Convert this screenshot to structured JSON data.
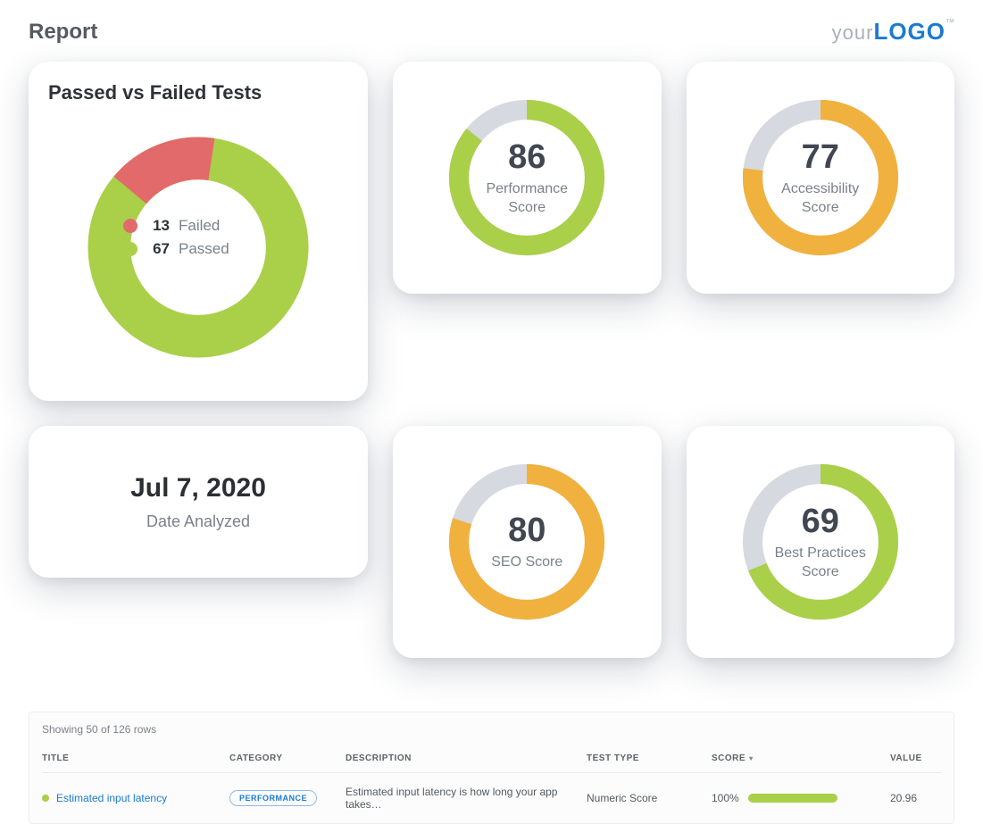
{
  "header": {
    "title": "Report",
    "logo_prefix": "your",
    "logo_brand": "LOGO",
    "logo_tm": "™"
  },
  "passfail": {
    "title": "Passed vs Failed Tests",
    "failed_label": "Failed",
    "failed_value": "13",
    "passed_label": "Passed",
    "passed_value": "67"
  },
  "date_card": {
    "value": "Jul 7, 2020",
    "label": "Date Analyzed"
  },
  "scores": {
    "performance": {
      "value": "86",
      "label": "Performance Score"
    },
    "accessibility": {
      "value": "77",
      "label": "Accessibility Score"
    },
    "seo": {
      "value": "80",
      "label": "SEO Score"
    },
    "best_practices": {
      "value": "69",
      "label": "Best Practices Score"
    }
  },
  "table": {
    "row_count_text": "Showing 50 of 126 rows",
    "headers": {
      "title": "TITLE",
      "category": "CATEGORY",
      "description": "DESCRIPTION",
      "test_type": "TEST TYPE",
      "score": "SCORE",
      "value": "VALUE"
    },
    "rows": [
      {
        "title": "Estimated input latency",
        "category": "PERFORMANCE",
        "description": "Estimated input latency is how long your app takes…",
        "test_type": "Numeric Score",
        "score": "100%",
        "value": "20.96"
      }
    ]
  },
  "colors": {
    "green": "#a9d048",
    "red": "#e36a6a",
    "orange": "#f0b13e",
    "grey": "#d6d9e0"
  },
  "chart_data": [
    {
      "type": "pie",
      "title": "Passed vs Failed Tests",
      "series": [
        {
          "name": "Failed",
          "value": 13,
          "color": "#e36a6a"
        },
        {
          "name": "Passed",
          "value": 67,
          "color": "#a9d048"
        }
      ]
    },
    {
      "type": "pie",
      "title": "Performance Score",
      "series": [
        {
          "name": "Score",
          "value": 86,
          "color": "#a9d048"
        },
        {
          "name": "Remaining",
          "value": 14,
          "color": "#d6d9e0"
        }
      ],
      "ylim": [
        0,
        100
      ]
    },
    {
      "type": "pie",
      "title": "Accessibility Score",
      "series": [
        {
          "name": "Score",
          "value": 77,
          "color": "#f0b13e"
        },
        {
          "name": "Remaining",
          "value": 23,
          "color": "#d6d9e0"
        }
      ],
      "ylim": [
        0,
        100
      ]
    },
    {
      "type": "pie",
      "title": "SEO Score",
      "series": [
        {
          "name": "Score",
          "value": 80,
          "color": "#f0b13e"
        },
        {
          "name": "Remaining",
          "value": 20,
          "color": "#d6d9e0"
        }
      ],
      "ylim": [
        0,
        100
      ]
    },
    {
      "type": "pie",
      "title": "Best Practices Score",
      "series": [
        {
          "name": "Score",
          "value": 69,
          "color": "#a9d048"
        },
        {
          "name": "Remaining",
          "value": 31,
          "color": "#d6d9e0"
        }
      ],
      "ylim": [
        0,
        100
      ]
    }
  ]
}
